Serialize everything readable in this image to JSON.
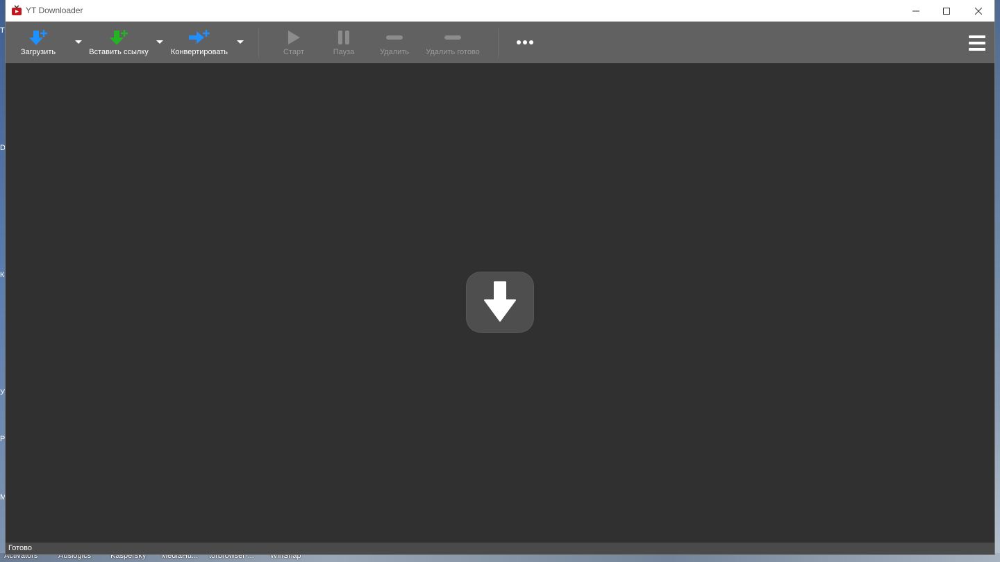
{
  "window": {
    "title": "YT Downloader",
    "controls": {
      "minimize": "minimize",
      "maximize": "maximize",
      "close": "close"
    }
  },
  "toolbar": {
    "download_label": "Загрузить",
    "paste_link_label": "Вставить ссылку",
    "convert_label": "Конвертировать",
    "start_label": "Старт",
    "pause_label": "Пауза",
    "delete_label": "Удалить",
    "delete_done_label": "Удалить готово"
  },
  "colors": {
    "accent_blue": "#1e90ff",
    "accent_green": "#22b422",
    "toolbar_bg": "#616161",
    "content_bg": "#303030",
    "disabled_icon": "#8c8c8c"
  },
  "icons": {
    "download": "download-plus-icon",
    "paste_link": "paste-link-plus-icon",
    "convert": "convert-plus-icon",
    "start": "play-icon",
    "pause": "pause-icon",
    "delete": "minus-icon",
    "delete_done": "minus-icon",
    "more": "more-dots-icon",
    "menu": "hamburger-menu-icon",
    "drop": "download-arrow-icon"
  },
  "status": {
    "text": "Готово"
  },
  "taskbar": {
    "items": [
      "Activators",
      "Auslogics",
      "Kaspersky",
      "MediaHu...",
      "torbrowser-...",
      "WinSnap"
    ]
  },
  "desktop_edge_letters": [
    "Т",
    "D",
    "К",
    "У",
    "Р",
    "М"
  ]
}
